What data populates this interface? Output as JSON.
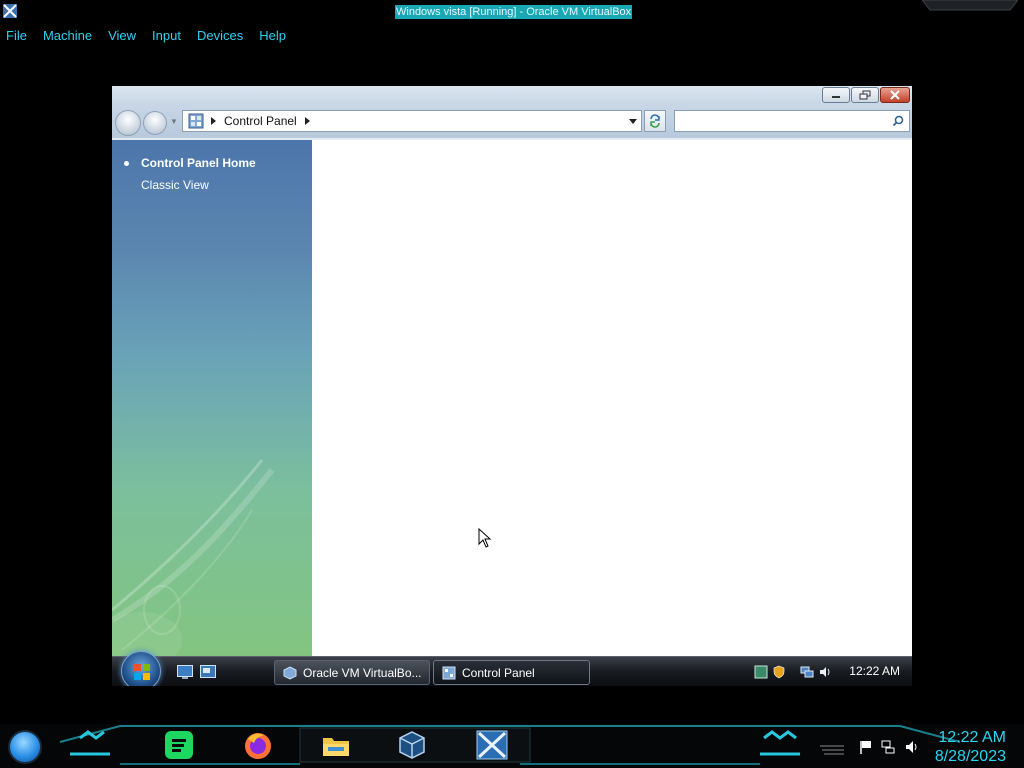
{
  "host": {
    "window_title": "Windows vista [Running] - Oracle VM VirtualBox",
    "menu": [
      "File",
      "Machine",
      "View",
      "Input",
      "Devices",
      "Help"
    ]
  },
  "explorer": {
    "address_breadcrumb": "Control Panel",
    "search_placeholder": "",
    "taskpane": {
      "home_label": "Control Panel Home",
      "classic_label": "Classic View"
    }
  },
  "guest_taskbar": {
    "tasks": [
      {
        "label": "Oracle VM VirtualBo...",
        "icon": "virtualbox-icon",
        "active": false
      },
      {
        "label": "Control Panel",
        "icon": "control-panel-icon",
        "active": true
      }
    ],
    "clock": "12:22 AM"
  },
  "host_taskbar": {
    "apps": [
      "spotify-icon",
      "firefox-icon",
      "file-explorer-icon",
      "virtualbox-icon",
      "vista-vm-icon"
    ],
    "clock_time": "12:22 AM",
    "clock_date": "8/28/2023",
    "accent_color": "#2bd4f0"
  }
}
